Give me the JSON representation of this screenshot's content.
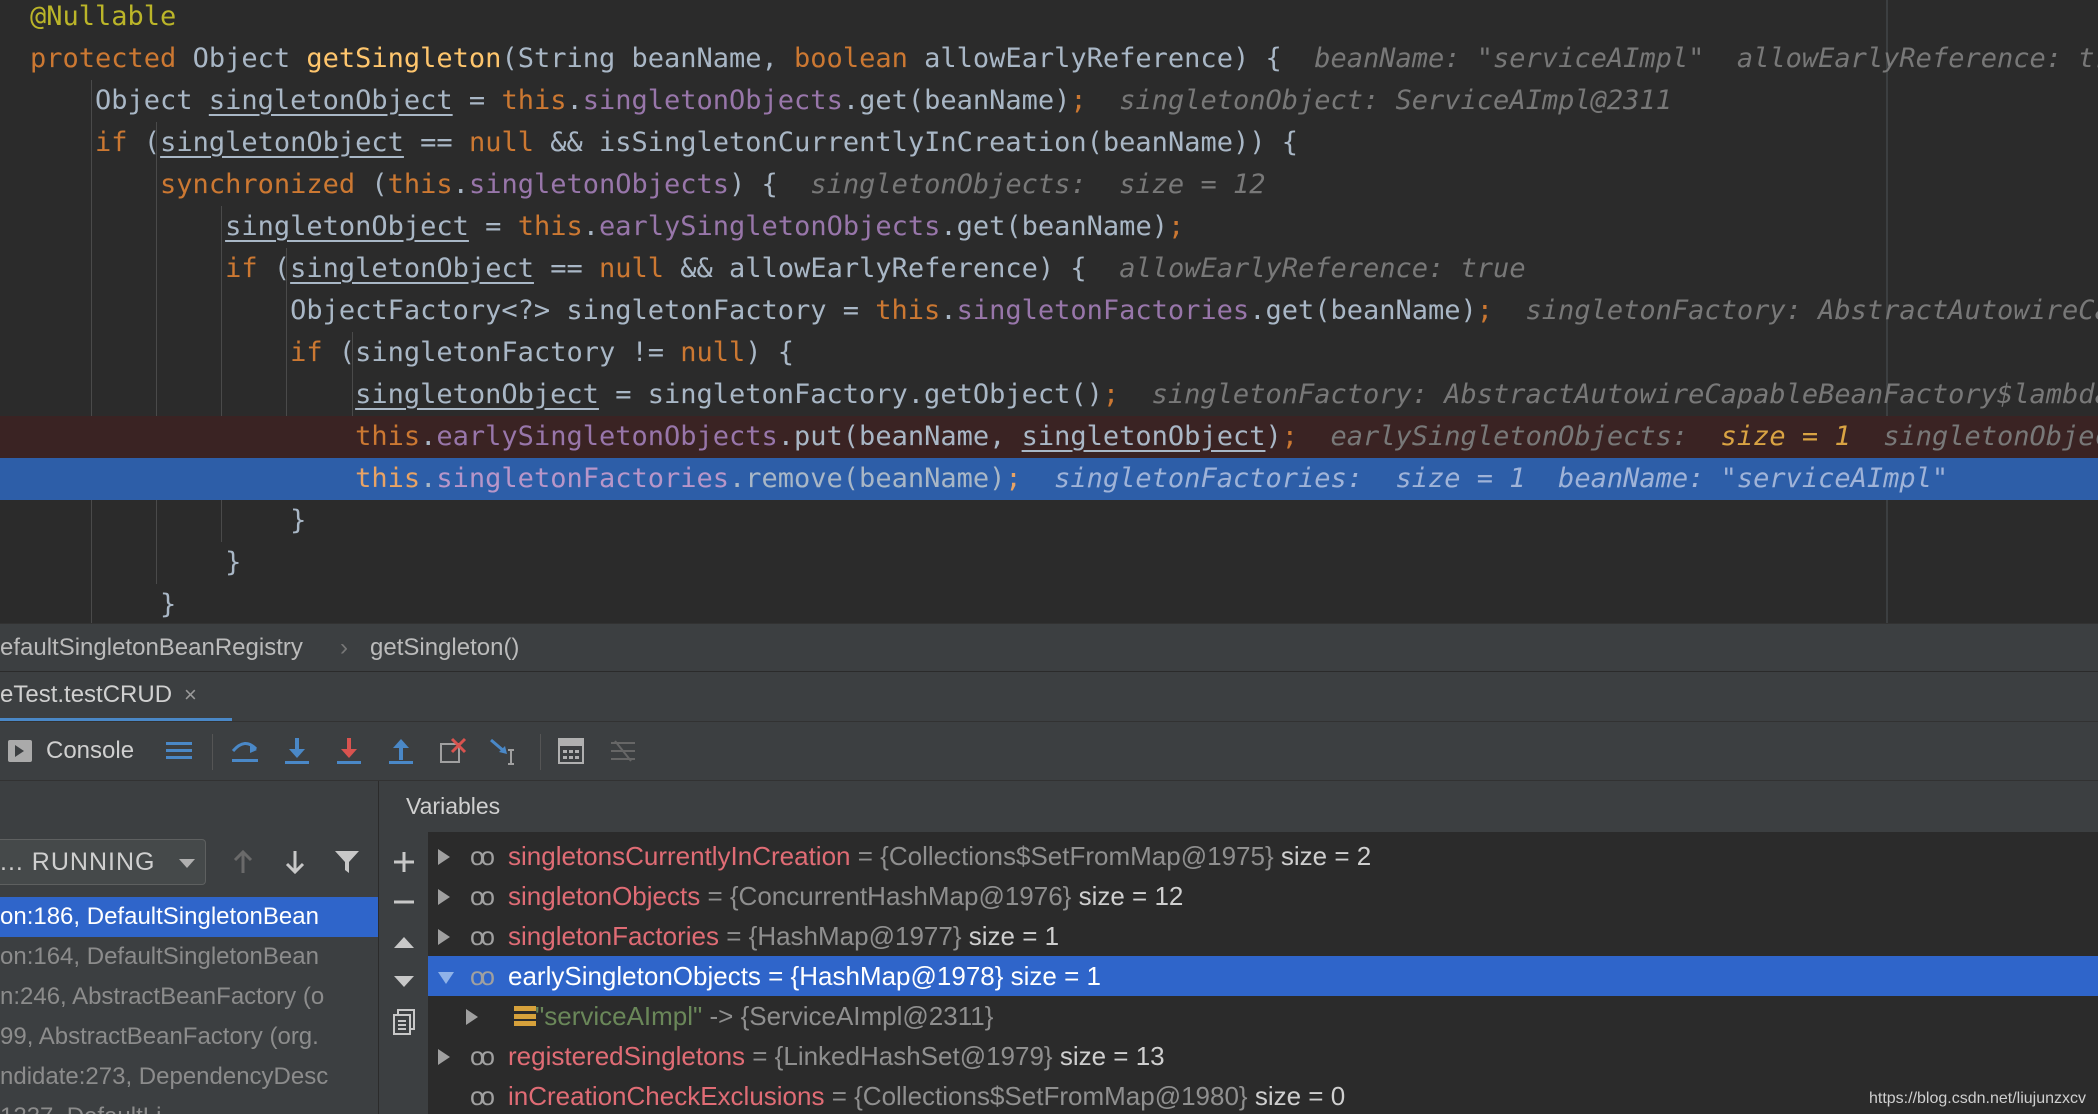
{
  "editor": {
    "lines": [
      {
        "tokens": [
          {
            "t": "@Nullable",
            "c": "ann"
          }
        ]
      },
      {
        "tokens": [
          {
            "t": "protected ",
            "c": "kw"
          },
          {
            "t": "Object ",
            "c": "plain"
          },
          {
            "t": "getSingleton",
            "c": "fn"
          },
          {
            "t": "(String beanName, ",
            "c": "plain"
          },
          {
            "t": "boolean ",
            "c": "kw"
          },
          {
            "t": "allowEarlyReference) {  ",
            "c": "plain"
          },
          {
            "t": "beanName: \"serviceAImpl\"  allowEarlyReference: true",
            "c": "hint"
          }
        ]
      },
      {
        "tokens": [
          {
            "t": "    Object ",
            "c": "plain"
          },
          {
            "t": "singletonObject",
            "c": "var"
          },
          {
            "t": " = ",
            "c": "plain"
          },
          {
            "t": "this",
            "c": "kw"
          },
          {
            "t": ".",
            "c": "plain"
          },
          {
            "t": "singletonObjects",
            "c": "field"
          },
          {
            "t": ".get(beanName)",
            "c": "plain"
          },
          {
            "t": ";  ",
            "c": "kw"
          },
          {
            "t": "singletonObject: ServiceAImpl@2311",
            "c": "hint"
          }
        ]
      },
      {
        "tokens": [
          {
            "t": "    ",
            "c": "plain"
          },
          {
            "t": "if ",
            "c": "kw"
          },
          {
            "t": "(",
            "c": "plain"
          },
          {
            "t": "singletonObject",
            "c": "var"
          },
          {
            "t": " == ",
            "c": "plain"
          },
          {
            "t": "null ",
            "c": "kw"
          },
          {
            "t": "&& isSingletonCurrentlyInCreation(beanName)) {",
            "c": "plain"
          }
        ]
      },
      {
        "tokens": [
          {
            "t": "        ",
            "c": "plain"
          },
          {
            "t": "synchronized ",
            "c": "kw"
          },
          {
            "t": "(",
            "c": "plain"
          },
          {
            "t": "this",
            "c": "kw"
          },
          {
            "t": ".",
            "c": "plain"
          },
          {
            "t": "singletonObjects",
            "c": "field"
          },
          {
            "t": ") {  ",
            "c": "plain"
          },
          {
            "t": "singletonObjects:  size = 12",
            "c": "hint"
          }
        ]
      },
      {
        "tokens": [
          {
            "t": "            ",
            "c": "plain"
          },
          {
            "t": "singletonObject",
            "c": "var"
          },
          {
            "t": " = ",
            "c": "plain"
          },
          {
            "t": "this",
            "c": "kw"
          },
          {
            "t": ".",
            "c": "plain"
          },
          {
            "t": "earlySingletonObjects",
            "c": "field"
          },
          {
            "t": ".get(beanName)",
            "c": "plain"
          },
          {
            "t": ";",
            "c": "kw"
          }
        ]
      },
      {
        "tokens": [
          {
            "t": "            ",
            "c": "plain"
          },
          {
            "t": "if ",
            "c": "kw"
          },
          {
            "t": "(",
            "c": "plain"
          },
          {
            "t": "singletonObject",
            "c": "var"
          },
          {
            "t": " == ",
            "c": "plain"
          },
          {
            "t": "null ",
            "c": "kw"
          },
          {
            "t": "&& allowEarlyReference) {  ",
            "c": "plain"
          },
          {
            "t": "allowEarlyReference: true",
            "c": "hint"
          }
        ]
      },
      {
        "tokens": [
          {
            "t": "                ObjectFactory<?> singletonFactory = ",
            "c": "plain"
          },
          {
            "t": "this",
            "c": "kw"
          },
          {
            "t": ".",
            "c": "plain"
          },
          {
            "t": "singletonFactories",
            "c": "field"
          },
          {
            "t": ".get(beanName)",
            "c": "plain"
          },
          {
            "t": ";  ",
            "c": "kw"
          },
          {
            "t": "singletonFactory: AbstractAutowireCapa",
            "c": "hint"
          }
        ]
      },
      {
        "tokens": [
          {
            "t": "                ",
            "c": "plain"
          },
          {
            "t": "if ",
            "c": "kw"
          },
          {
            "t": "(singletonFactory != ",
            "c": "plain"
          },
          {
            "t": "null",
            "c": "kw"
          },
          {
            "t": ") {",
            "c": "plain"
          }
        ]
      },
      {
        "tokens": [
          {
            "t": "                    ",
            "c": "plain"
          },
          {
            "t": "singletonObject",
            "c": "var"
          },
          {
            "t": " = singletonFactory.getObject()",
            "c": "plain"
          },
          {
            "t": ";  ",
            "c": "kw"
          },
          {
            "t": "singletonFactory: AbstractAutowireCapableBeanFactory$lambda@",
            "c": "hint"
          }
        ]
      },
      {
        "tokens": [
          {
            "t": "                    ",
            "c": "plain"
          },
          {
            "t": "this",
            "c": "kw"
          },
          {
            "t": ".",
            "c": "plain"
          },
          {
            "t": "earlySingletonObjects",
            "c": "field"
          },
          {
            "t": ".put(beanName, ",
            "c": "plain"
          },
          {
            "t": "singletonObject",
            "c": "var"
          },
          {
            "t": ")",
            "c": "plain"
          },
          {
            "t": ";  ",
            "c": "kw"
          },
          {
            "t": "earlySingletonObjects:  ",
            "c": "hint"
          },
          {
            "t": "size = 1",
            "c": "hint-hl"
          },
          {
            "t": "  singletonObject",
            "c": "hint"
          }
        ]
      },
      {
        "tokens": [
          {
            "t": "                    ",
            "c": "plain"
          },
          {
            "t": "this",
            "c": "kw"
          },
          {
            "t": ".",
            "c": "plain"
          },
          {
            "t": "singletonFactories",
            "c": "field"
          },
          {
            "t": ".remove(beanName)",
            "c": "plain"
          },
          {
            "t": ";  ",
            "c": "kw"
          },
          {
            "t": "singletonFactories:  size = 1  beanName: \"serviceAImpl\"",
            "c": "hint"
          }
        ]
      },
      {
        "tokens": [
          {
            "t": "                }",
            "c": "plain"
          }
        ]
      },
      {
        "tokens": [
          {
            "t": "            }",
            "c": "plain"
          }
        ]
      },
      {
        "tokens": [
          {
            "t": "        }",
            "c": "plain"
          }
        ]
      }
    ]
  },
  "breadcrumbs": {
    "class_name": "efaultSingletonBeanRegistry",
    "separator": "›",
    "method": "getSingleton()"
  },
  "debug_tab": {
    "label": "eTest.testCRUD",
    "close": "×"
  },
  "toolbar": {
    "console_label": "Console"
  },
  "frames": {
    "thread_label": "... RUNNING",
    "rows": [
      {
        "text": "on:186, DefaultSingletonBean"
      },
      {
        "text": "on:164, DefaultSingletonBean"
      },
      {
        "text": "n:246, AbstractBeanFactory (o"
      },
      {
        "text": "99, AbstractBeanFactory (org."
      },
      {
        "text": "ndidate:273, DependencyDesc"
      },
      {
        "text": "                  1237, DefaultLi"
      }
    ]
  },
  "variables": {
    "header": "Variables",
    "rows": [
      {
        "name": "singletonsCurrentlyInCreation",
        "value": " = {Collections$SetFromMap@1975} ",
        "size": " size = 2"
      },
      {
        "name": "singletonObjects",
        "value": " = {ConcurrentHashMap@1976} ",
        "size": " size = 12"
      },
      {
        "name": "singletonFactories",
        "value": " = {HashMap@1977} ",
        "size": " size = 1"
      },
      {
        "name": "earlySingletonObjects",
        "value": " = {HashMap@1978} ",
        "size": " size = 1"
      },
      {
        "entry": "\"serviceAImpl\"",
        "entry_value": " -> {ServiceAImpl@2311}"
      },
      {
        "name": "registeredSingletons",
        "value": " = {LinkedHashSet@1979} ",
        "size": " size = 13"
      },
      {
        "name": "inCreationCheckExclusions",
        "value": " = {Collections$SetFromMap@1980} ",
        "size": " size = 0"
      }
    ]
  },
  "watermark": "https://blog.csdn.net/liujunzxcv"
}
